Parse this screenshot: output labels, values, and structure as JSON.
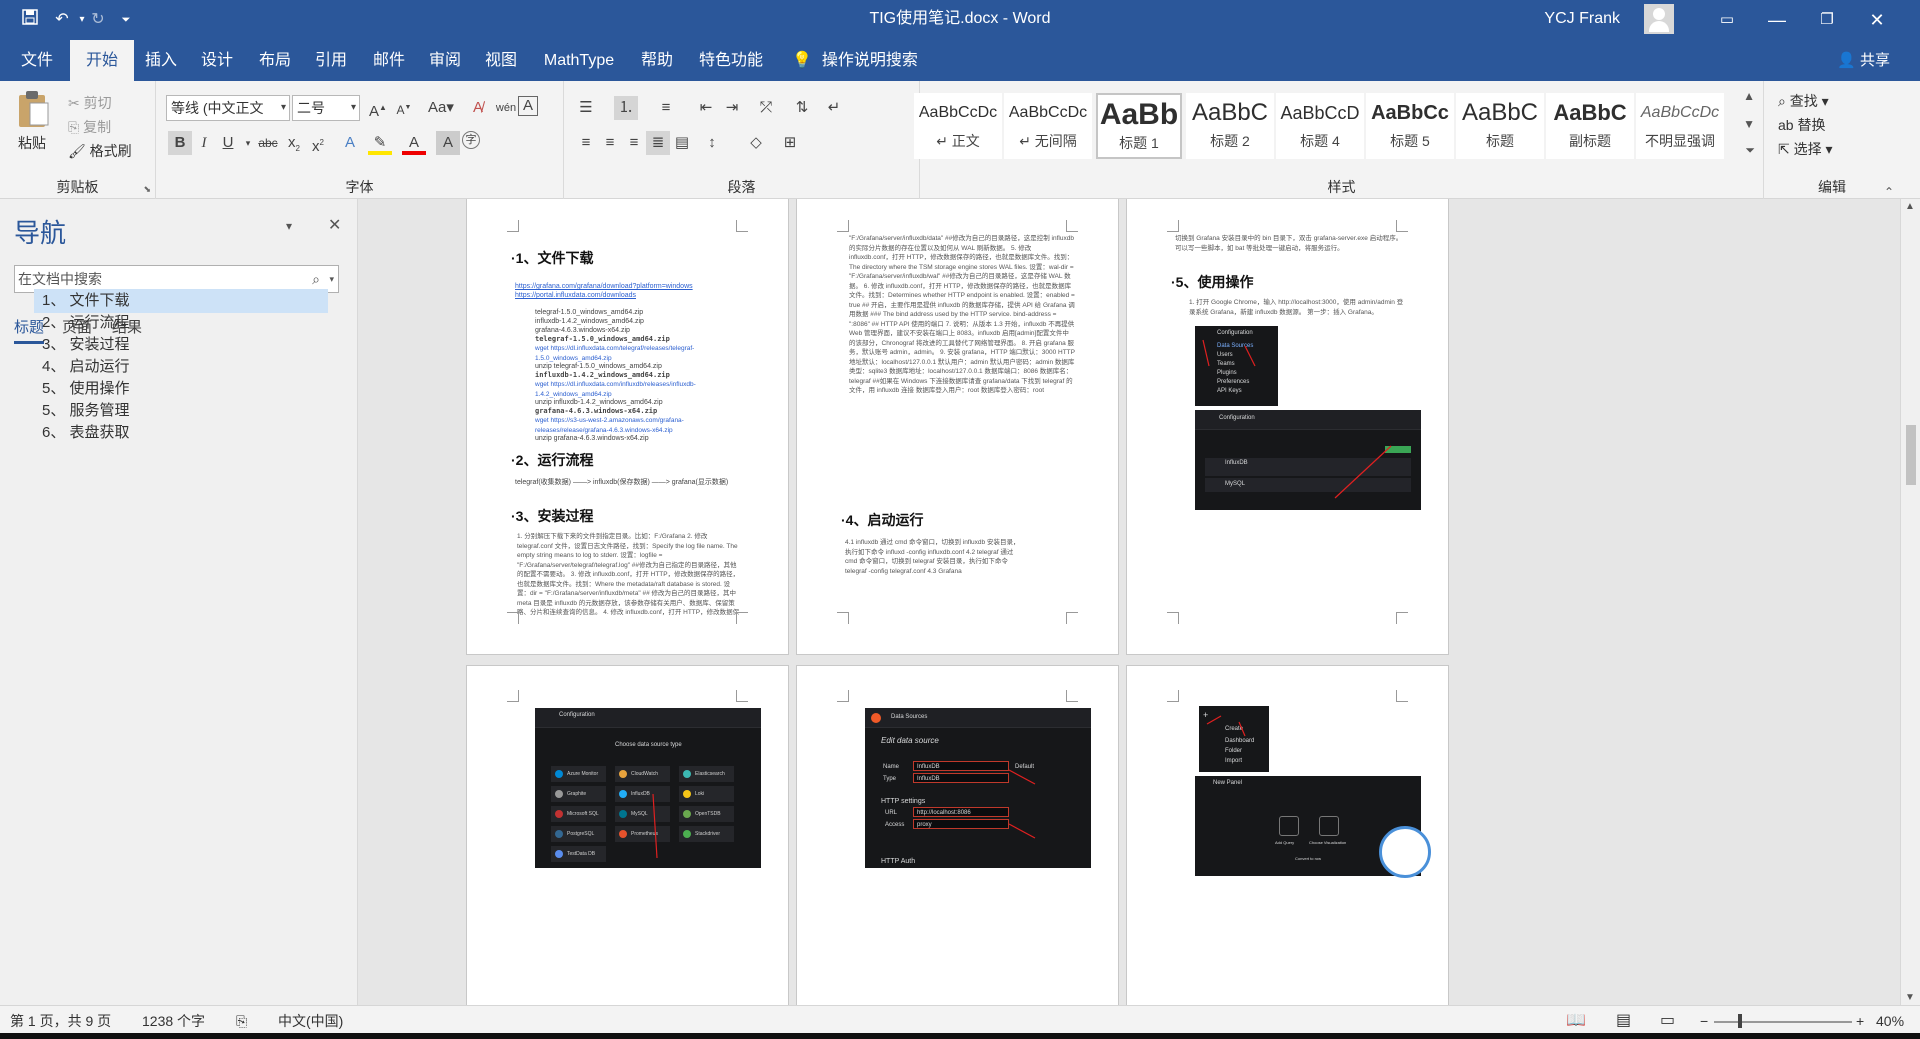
{
  "titlebar": {
    "doc_title": "TIG使用笔记.docx  -  Word",
    "user": "YCJ Frank",
    "save_icon": "save-icon",
    "undo_icon": "undo-icon",
    "redo_icon": "redo-icon",
    "customize_icon": "customize-quick-access-icon"
  },
  "tabs": [
    "文件",
    "开始",
    "插入",
    "设计",
    "布局",
    "引用",
    "邮件",
    "审阅",
    "视图",
    "MathType",
    "帮助",
    "特色功能"
  ],
  "tellme": "操作说明搜索",
  "share": "共享",
  "ribbon": {
    "clipboard": {
      "paste": "粘贴",
      "cut": "剪切",
      "copy": "复制",
      "format_painter": "格式刷",
      "label": "剪贴板"
    },
    "font": {
      "font_name": "等线 (中文正文",
      "font_size": "二号",
      "label": "字体"
    },
    "paragraph": {
      "label": "段落"
    },
    "styles": {
      "label": "样式",
      "items": [
        {
          "sample": "AaBbCcDc",
          "name": "↵ 正文"
        },
        {
          "sample": "AaBbCcDc",
          "name": "↵ 无间隔"
        },
        {
          "sample": "AaBb",
          "name": "标题 1"
        },
        {
          "sample": "AaBbC",
          "name": "标题 2"
        },
        {
          "sample": "AaBbCcD",
          "name": "标题 4"
        },
        {
          "sample": "AaBbCc",
          "name": "标题 5"
        },
        {
          "sample": "AaBbC",
          "name": "标题"
        },
        {
          "sample": "AaBbC",
          "name": "副标题"
        },
        {
          "sample": "AaBbCcDc",
          "name": "不明显强调"
        }
      ]
    },
    "editing": {
      "find": "查找",
      "replace": "替换",
      "select": "选择",
      "label": "编辑"
    }
  },
  "nav": {
    "title": "导航",
    "search_placeholder": "在文档中搜索",
    "tabs": [
      "标题",
      "页面",
      "结果"
    ],
    "headings": [
      "1、 文件下载",
      "2、 运行流程",
      "3、 安装过程",
      "4、 启动运行",
      "5、 使用操作",
      "5、 服务管理",
      "6、 表盘获取"
    ]
  },
  "pages": {
    "p1": {
      "h_download": "·1、文件下载",
      "links": [
        "https://grafana.com/grafana/download?platform=windows",
        "https://portal.influxdata.com/downloads"
      ],
      "files": [
        "telegraf-1.5.0_windows_amd64.zip",
        "influxdb-1.4.2_windows_amd64.zip",
        "grafana-4.6.3.windows-x64.zip",
        "telegraf-1.5.0_windows_amd64.zip",
        "wget https://dl.influxdata.com/telegraf/releases/telegraf-1.5.0_windows_amd64.zip",
        "unzip telegraf-1.5.0_windows_amd64.zip",
        "influxdb-1.4.2_windows_amd64.zip",
        "wget https://dl.influxdata.com/influxdb/releases/influxdb-1.4.2_windows_amd64.zip",
        "unzip influxdb-1.4.2_windows_amd64.zip",
        "grafana-4.6.3.windows-x64.zip",
        "wget https://s3-us-west-2.amazonaws.com/grafana-releases/release/grafana-4.6.3.windows-x64.zip",
        "unzip grafana-4.6.3.windows-x64.zip"
      ],
      "h_flow": "·2、运行流程",
      "flow": "telegraf(收集数据) ——> influxdb(保存数据) ——> grafana(显示数据)",
      "h_install": "·3、安装过程",
      "install_text": "1. 分别解压下载下来的文件到指定目录。比如：F:/Grafana  2. 修改 telegraf.conf 文件，设置日志文件路径，找到：Specify the log file name. The empty string means to log to stderr. 设置：logfile = \"F:/Grafana/server/telegraf/telegraf.log\" ##修改为自己指定的目录路径，其他的配置不需要动。 3. 修改 influxdb.conf，打开 HTTP，修改数据保存的路径，也就是数据库文件。找到：Where the metadata/raft database is stored. 设置：dir = \"F:/Grafana/server/influxdb/meta\" ## 修改为自己的目录路径，其中 meta 目录是 influxdb 的元数据存放，该参数存储有关用户、数据库、保留策略、分片和连续查询的信息。 4. 修改 influxdb.conf，打开 HTTP，修改数据保存的路径，也就是数据库文件。找到：The directory where the TSM storage engine stores TSM files. 设置：dir ="
    },
    "p2": {
      "text": "\"F:/Grafana/server/influxdb/data\"  ##修改为自己的目录路径，这是控制 influxdb 的实际分片数据的存在位置以及如何从 WAL 刷新数据。 5. 修改 influxdb.conf，打开 HTTP，修改数据保存的路径，也就是数据库文件。找到：The directory where the TSM storage engine stores WAL files. 设置：wal-dir = \"F:/Grafana/server/influxdb/wal\"  ##修改为自己的目录路径，这是存储 WAL 数据。 6. 修改 influxdb.conf，打开 HTTP，修改数据保存的路径，也就是数据库文件。找到：Determines whether HTTP endpoint is enabled. 设置：enabled = true  ## 开启，主要作用是提供 influxdb 的数据库存储，提供 API 给 Grafana 调用数据  ### The bind address used by the HTTP service. bind-address = \":8086\"  ## HTTP API 使用的端口 7. 说明：从版本 1.3 开始，influxdb 不再提供 Web 管理界面，建议不安装在端口上 8083。influxdb 启用[admin]配置文件中的该部分，Chronograf 将改进的工具替代了网络管理界面。 8. 开启 grafana 服务，默认账号 admin，admin。 9. 安装 grafana，HTTP 端口默认：3000  HTTP 地址默认：localhost/127.0.0.1  默认用户：admin  默认用户密码：admin  数据库类型：sqlite3  数据库地址：localhost/127.0.0.1  数据库端口：8086  数据库名：telegraf  ##如果在 Windows 下连接数据库请查 grafana/data 下找到 telegraf 的文件，用 influxdb 连接  数据库登入用户：root  数据库登入密码：root",
      "h_start": "·4、启动运行",
      "start_text": "4.1 influxdb  通过 cmd 命令窗口，切换到 influxdb 安装目录，执行如下命令  influxd -config influxdb.conf  4.2 telegraf  通过 cmd 命令窗口，切换到 telegraf 安装目录，执行如下命令  telegraf -config telegraf.conf  4.3 Grafana"
    },
    "p3": {
      "intro": "切换到 Grafana 安装目录中的 bin 目录下，双击 grafana-server.exe 启动程序。可以写一些脚本，如 bat 等批处理一键启动，将服务运行。",
      "h_use": "·5、使用操作",
      "use_text": "1. 打开 Google Chrome，输入 http://localhost:3000，使用 admin/admin 登录系统 Grafana，新建 influxdb 数据源。  第一步：插入 Grafana。",
      "config_title": "Configuration",
      "menu": [
        "Data Sources",
        "Users",
        "Teams",
        "Plugins",
        "Preferences",
        "API Keys"
      ],
      "influx_label": "InfluxDB",
      "mysql_label": "MySQL"
    },
    "p4": {
      "config_title": "Configuration",
      "choose": "Choose data source type",
      "types": [
        "Azure Monitor",
        "CloudWatch",
        "Elasticsearch",
        "Graphite",
        "InfluxDB",
        "Loki",
        "Microsoft SQL Server",
        "MySQL",
        "OpenTSDB",
        "PostgreSQL",
        "Prometheus",
        "Stackdriver",
        "TestData DB"
      ]
    },
    "p5": {
      "crumb": "Data Sources",
      "edit": "Edit data source",
      "name_label": "Name",
      "name_val": "InfluxDB",
      "type_label": "Type",
      "type_val": "InfluxDB",
      "default_label": "Default",
      "http": "HTTP settings",
      "url_label": "URL",
      "url_val": "http://localhost:8086",
      "access_label": "Access",
      "access_val": "proxy",
      "auth": "HTTP Auth"
    },
    "p6": {
      "create": "Create",
      "menu": [
        "Dashboard",
        "Folder",
        "Import"
      ],
      "new_panel": "New Panel",
      "add_query": "Add Query",
      "choose_vis": "Choose Visualization",
      "convert": "Convert to row"
    }
  },
  "status": {
    "page": "第 1 页，共 9 页",
    "words": "1238 个字",
    "lang": "中文(中国)",
    "zoom": "40%"
  },
  "colors": {
    "accent": "#2b579a",
    "ribbon": "#f3f3f3",
    "nav_selected": "#cde2f7"
  }
}
